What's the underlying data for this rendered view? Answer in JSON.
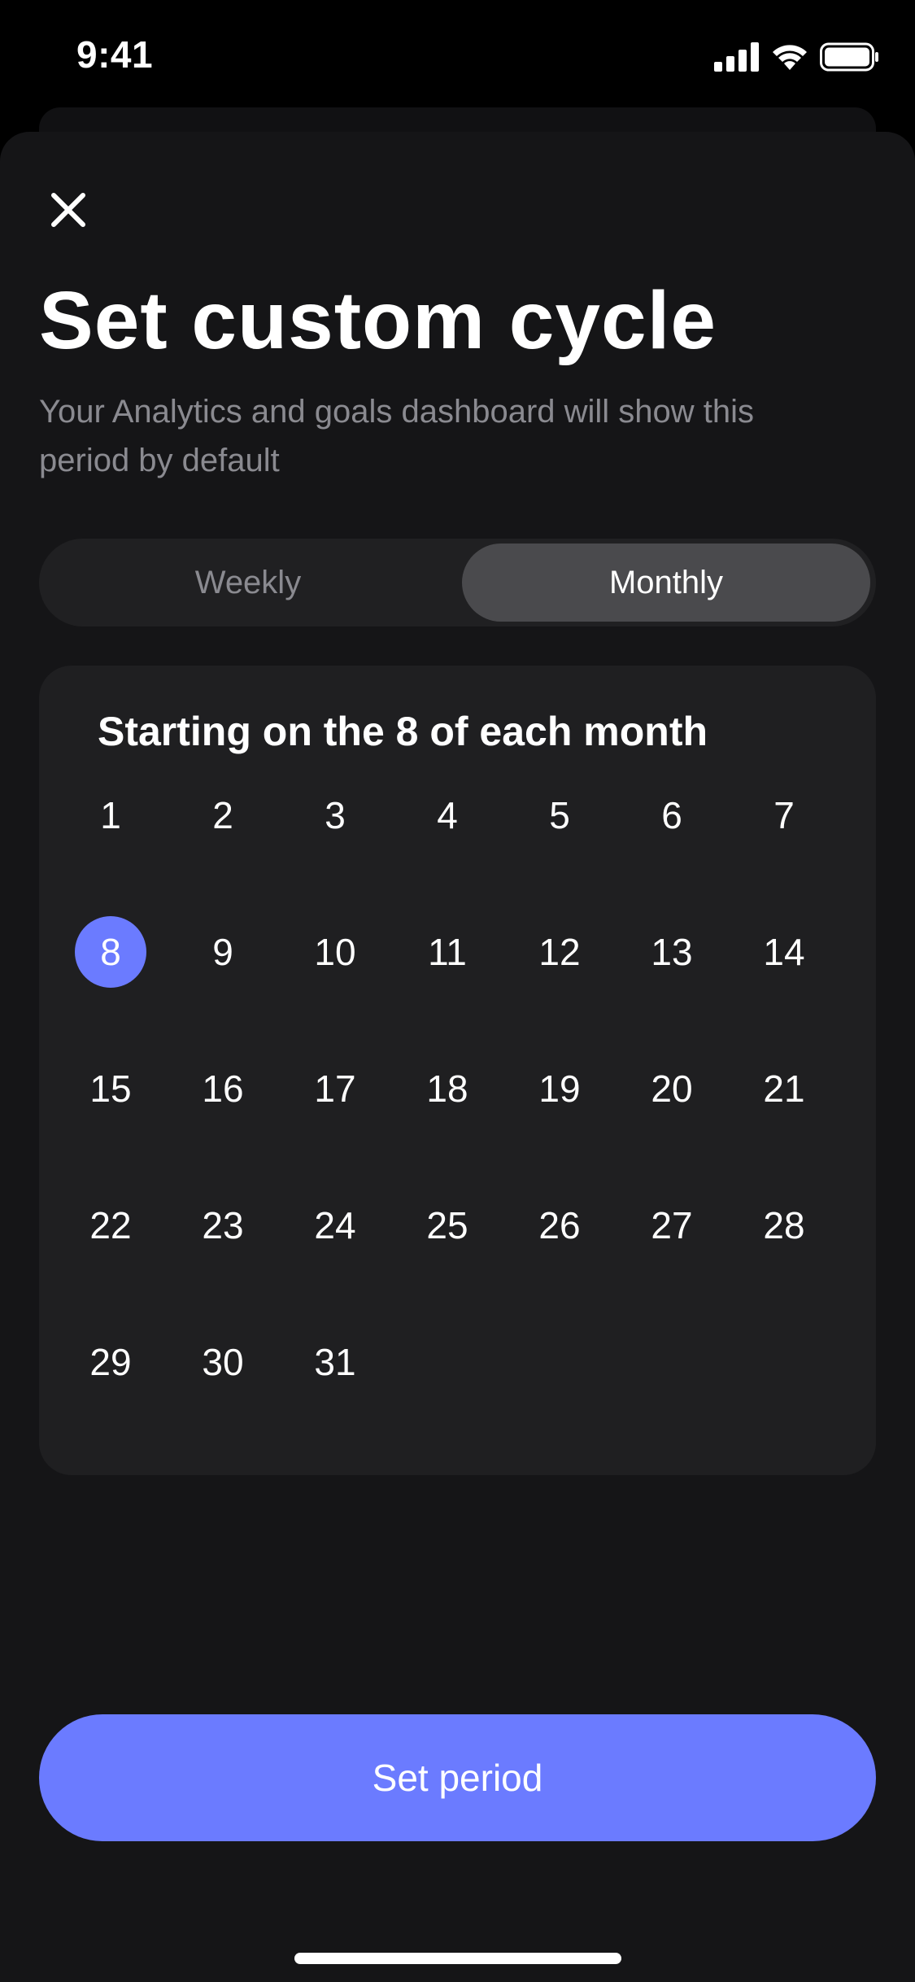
{
  "status_bar": {
    "time": "9:41",
    "icons": [
      "signal-icon",
      "wifi-icon",
      "battery-icon"
    ]
  },
  "sheet": {
    "close_icon": "close-icon",
    "title": "Set custom cycle",
    "subtitle": "Your Analytics and goals dashboard will show this period by default"
  },
  "cycle_toggle": {
    "options": [
      {
        "label": "Weekly",
        "selected": false
      },
      {
        "label": "Monthly",
        "selected": true
      }
    ]
  },
  "day_picker": {
    "heading": "Starting on the 8 of each month",
    "selected_day": "8",
    "days": [
      "1",
      "2",
      "3",
      "4",
      "5",
      "6",
      "7",
      "8",
      "9",
      "10",
      "11",
      "12",
      "13",
      "14",
      "15",
      "16",
      "17",
      "18",
      "19",
      "20",
      "21",
      "22",
      "23",
      "24",
      "25",
      "26",
      "27",
      "28",
      "29",
      "30",
      "31"
    ]
  },
  "primary_button": {
    "label": "Set period"
  },
  "colors": {
    "accent": "#6b7bff",
    "sheet_background": "#151517",
    "card_background": "#1f1f21",
    "secondary_text": "#8a8a90"
  }
}
